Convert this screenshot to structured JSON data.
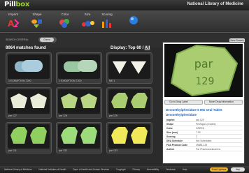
{
  "header": {
    "logo_prefix": "Pill",
    "logo_suffix": "box",
    "org": "National Library of Medicine"
  },
  "criteria": {
    "items": [
      {
        "label": "Imprint",
        "icon": "imprint-icon"
      },
      {
        "label": "Shape",
        "icon": "shape-icon"
      },
      {
        "label": "Color",
        "icon": "color-icon"
      },
      {
        "label": "Size",
        "icon": "size-icon"
      },
      {
        "label": "Scoring",
        "icon": "scoring-icon"
      }
    ],
    "new_search_label": "New Search"
  },
  "search": {
    "label": "SEARCH CRITERIA:",
    "pill_text": "Green"
  },
  "results": {
    "count_text": "8064 matches found",
    "display_text": "Display: Top 60",
    "all_text": "All"
  },
  "cards": [
    {
      "caption": "1 EXEMPTION T200",
      "color": "#8fb6c8",
      "shape": "oval"
    },
    {
      "caption": "1 EXEMPTION T200",
      "color": "#9bc6a4",
      "shape": "oval2"
    },
    {
      "caption": "ME 1",
      "color": "#f2f2e8",
      "shape": "triangles"
    },
    {
      "caption": "par 127",
      "color": "#e8ecd8",
      "shape": "pentagons"
    },
    {
      "caption": "par 128",
      "color": "#b9d685",
      "shape": "pentagons"
    },
    {
      "caption": "par 129",
      "color": "#a9cd70",
      "shape": "hexagons"
    },
    {
      "caption": "par 131",
      "color": "#8fd061",
      "shape": "hexagons"
    },
    {
      "caption": "par 132",
      "color": "#9cdc7a",
      "shape": "hexagons"
    },
    {
      "caption": "par 133",
      "color": "#f1e85a",
      "shape": "hexagons"
    }
  ],
  "detail": {
    "image_text_top": "par",
    "image_text_bottom": "129",
    "btn_left": "Go to Drug Label",
    "btn_right": "More Drug Information",
    "title": "Dexmethylphenidate 5 MG Oral Tablet",
    "subtitle": "Dexmethylphenidate",
    "rows": [
      {
        "k": "Imprint",
        "v": "par 129"
      },
      {
        "k": "Shape",
        "v": "Pentagon (5 sides)"
      },
      {
        "k": "Color",
        "v": "GREEN"
      },
      {
        "k": "Size (mm)",
        "v": "7.00"
      },
      {
        "k": "Scoring",
        "v": "2"
      },
      {
        "k": "DEA Schedule",
        "v": "Not Scheduled"
      },
      {
        "k": "FDA Product Code",
        "v": "49884-129"
      },
      {
        "k": "Author",
        "v": "Par Pharmaceutical Inc."
      }
    ]
  },
  "footer": {
    "links": [
      "National Library of Medicine",
      "National Institutes of Health",
      "Dept. of Health and Human Services",
      "Copyright",
      "Privacy",
      "Accessibility",
      "Feedback",
      "Help"
    ],
    "email_label": "Email Updates",
    "help_label": "Help"
  },
  "colors": {
    "accent_green": "#9bd13a",
    "link_blue": "#1a62b5",
    "email_orange": "#f0b030"
  }
}
